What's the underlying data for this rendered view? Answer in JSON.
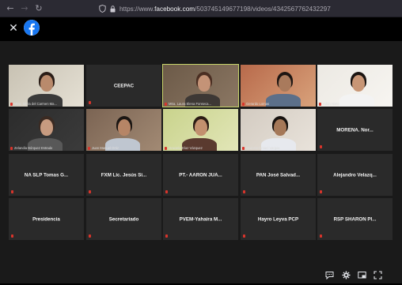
{
  "browser": {
    "back_icon": "arrow-left-icon",
    "forward_icon": "arrow-right-icon",
    "reload_icon": "reload-icon",
    "url_prefix": "https://www.",
    "url_host": "facebook.com",
    "url_path": "/503745149677198/videos/434256776243229​7"
  },
  "viewer": {
    "close_icon": "close-icon",
    "logo_icon": "facebook-logo-icon"
  },
  "tiles": [
    {
      "label": "Mtra. Silvia del Carmen Ma...",
      "kind": "video"
    },
    {
      "label": "CEEPAC",
      "kind": "name"
    },
    {
      "label": "Mtra. Laura Elena Fonseca...",
      "kind": "video",
      "speaking": true
    },
    {
      "label": "Gerardo Lomas",
      "kind": "video"
    },
    {
      "label": "Adán Nieto",
      "kind": "video"
    },
    {
      "label": "Zelandia Bórquez Estrada",
      "kind": "video"
    },
    {
      "label": "Juan Manuel Ortiz",
      "kind": "video"
    },
    {
      "label": "Graciela Díaz Vázquez",
      "kind": "video"
    },
    {
      "label": "Marcelo Ismael Vargas",
      "kind": "video"
    },
    {
      "label": "MORENA.  Nor...",
      "kind": "name"
    },
    {
      "label": "NA SLP Tomas G...",
      "kind": "name"
    },
    {
      "label": "FXM Lic. Jesús Si...",
      "kind": "name"
    },
    {
      "label": "PT.- AARÓN JUÁ...",
      "kind": "name"
    },
    {
      "label": "PAN José Salvad...",
      "kind": "name"
    },
    {
      "label": "Alejandro Velazq...",
      "kind": "name"
    },
    {
      "label": "Presidencia",
      "kind": "name"
    },
    {
      "label": "Secretariado",
      "kind": "name"
    },
    {
      "label": "PVEM-Yahaira M...",
      "kind": "name"
    },
    {
      "label": "Hayro Leyva PCP",
      "kind": "name"
    },
    {
      "label": "RSP SHARON PI...",
      "kind": "name"
    }
  ],
  "controls": {
    "icons": [
      "comment-icon",
      "settings-icon",
      "picture-in-picture-icon",
      "fullscreen-icon"
    ]
  },
  "colors": {
    "speaking_outline": "#c9d66b",
    "muted_mic": "#d9342b",
    "facebook_blue": "#1877f2"
  }
}
